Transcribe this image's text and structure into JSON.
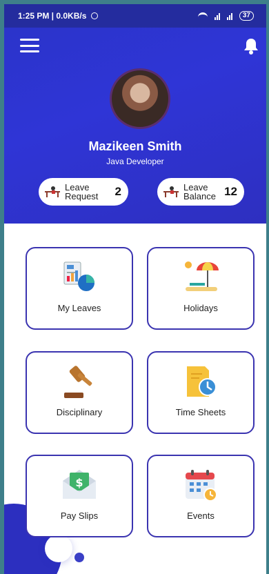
{
  "status_bar": {
    "time_speed": "1:25 PM | 0.0KB/s",
    "battery": "37"
  },
  "profile": {
    "name": "Mazikeen Smith",
    "role": "Java Developer"
  },
  "summary": {
    "leave_request": {
      "label_line1": "Leave",
      "label_line2": "Request",
      "count": "2"
    },
    "leave_balance": {
      "label_line1": "Leave",
      "label_line2": "Balance",
      "count": "12"
    }
  },
  "menu": {
    "items": [
      {
        "label": "My Leaves",
        "icon": "report-chart-icon"
      },
      {
        "label": "Holidays",
        "icon": "beach-umbrella-icon"
      },
      {
        "label": "Disciplinary",
        "icon": "gavel-icon"
      },
      {
        "label": "Time Sheets",
        "icon": "timesheet-clock-icon"
      },
      {
        "label": "Pay Slips",
        "icon": "money-envelope-icon"
      },
      {
        "label": "Events",
        "icon": "calendar-icon"
      }
    ]
  },
  "colors": {
    "header_bg": "#2f35d6",
    "card_border": "#3a33b0"
  }
}
